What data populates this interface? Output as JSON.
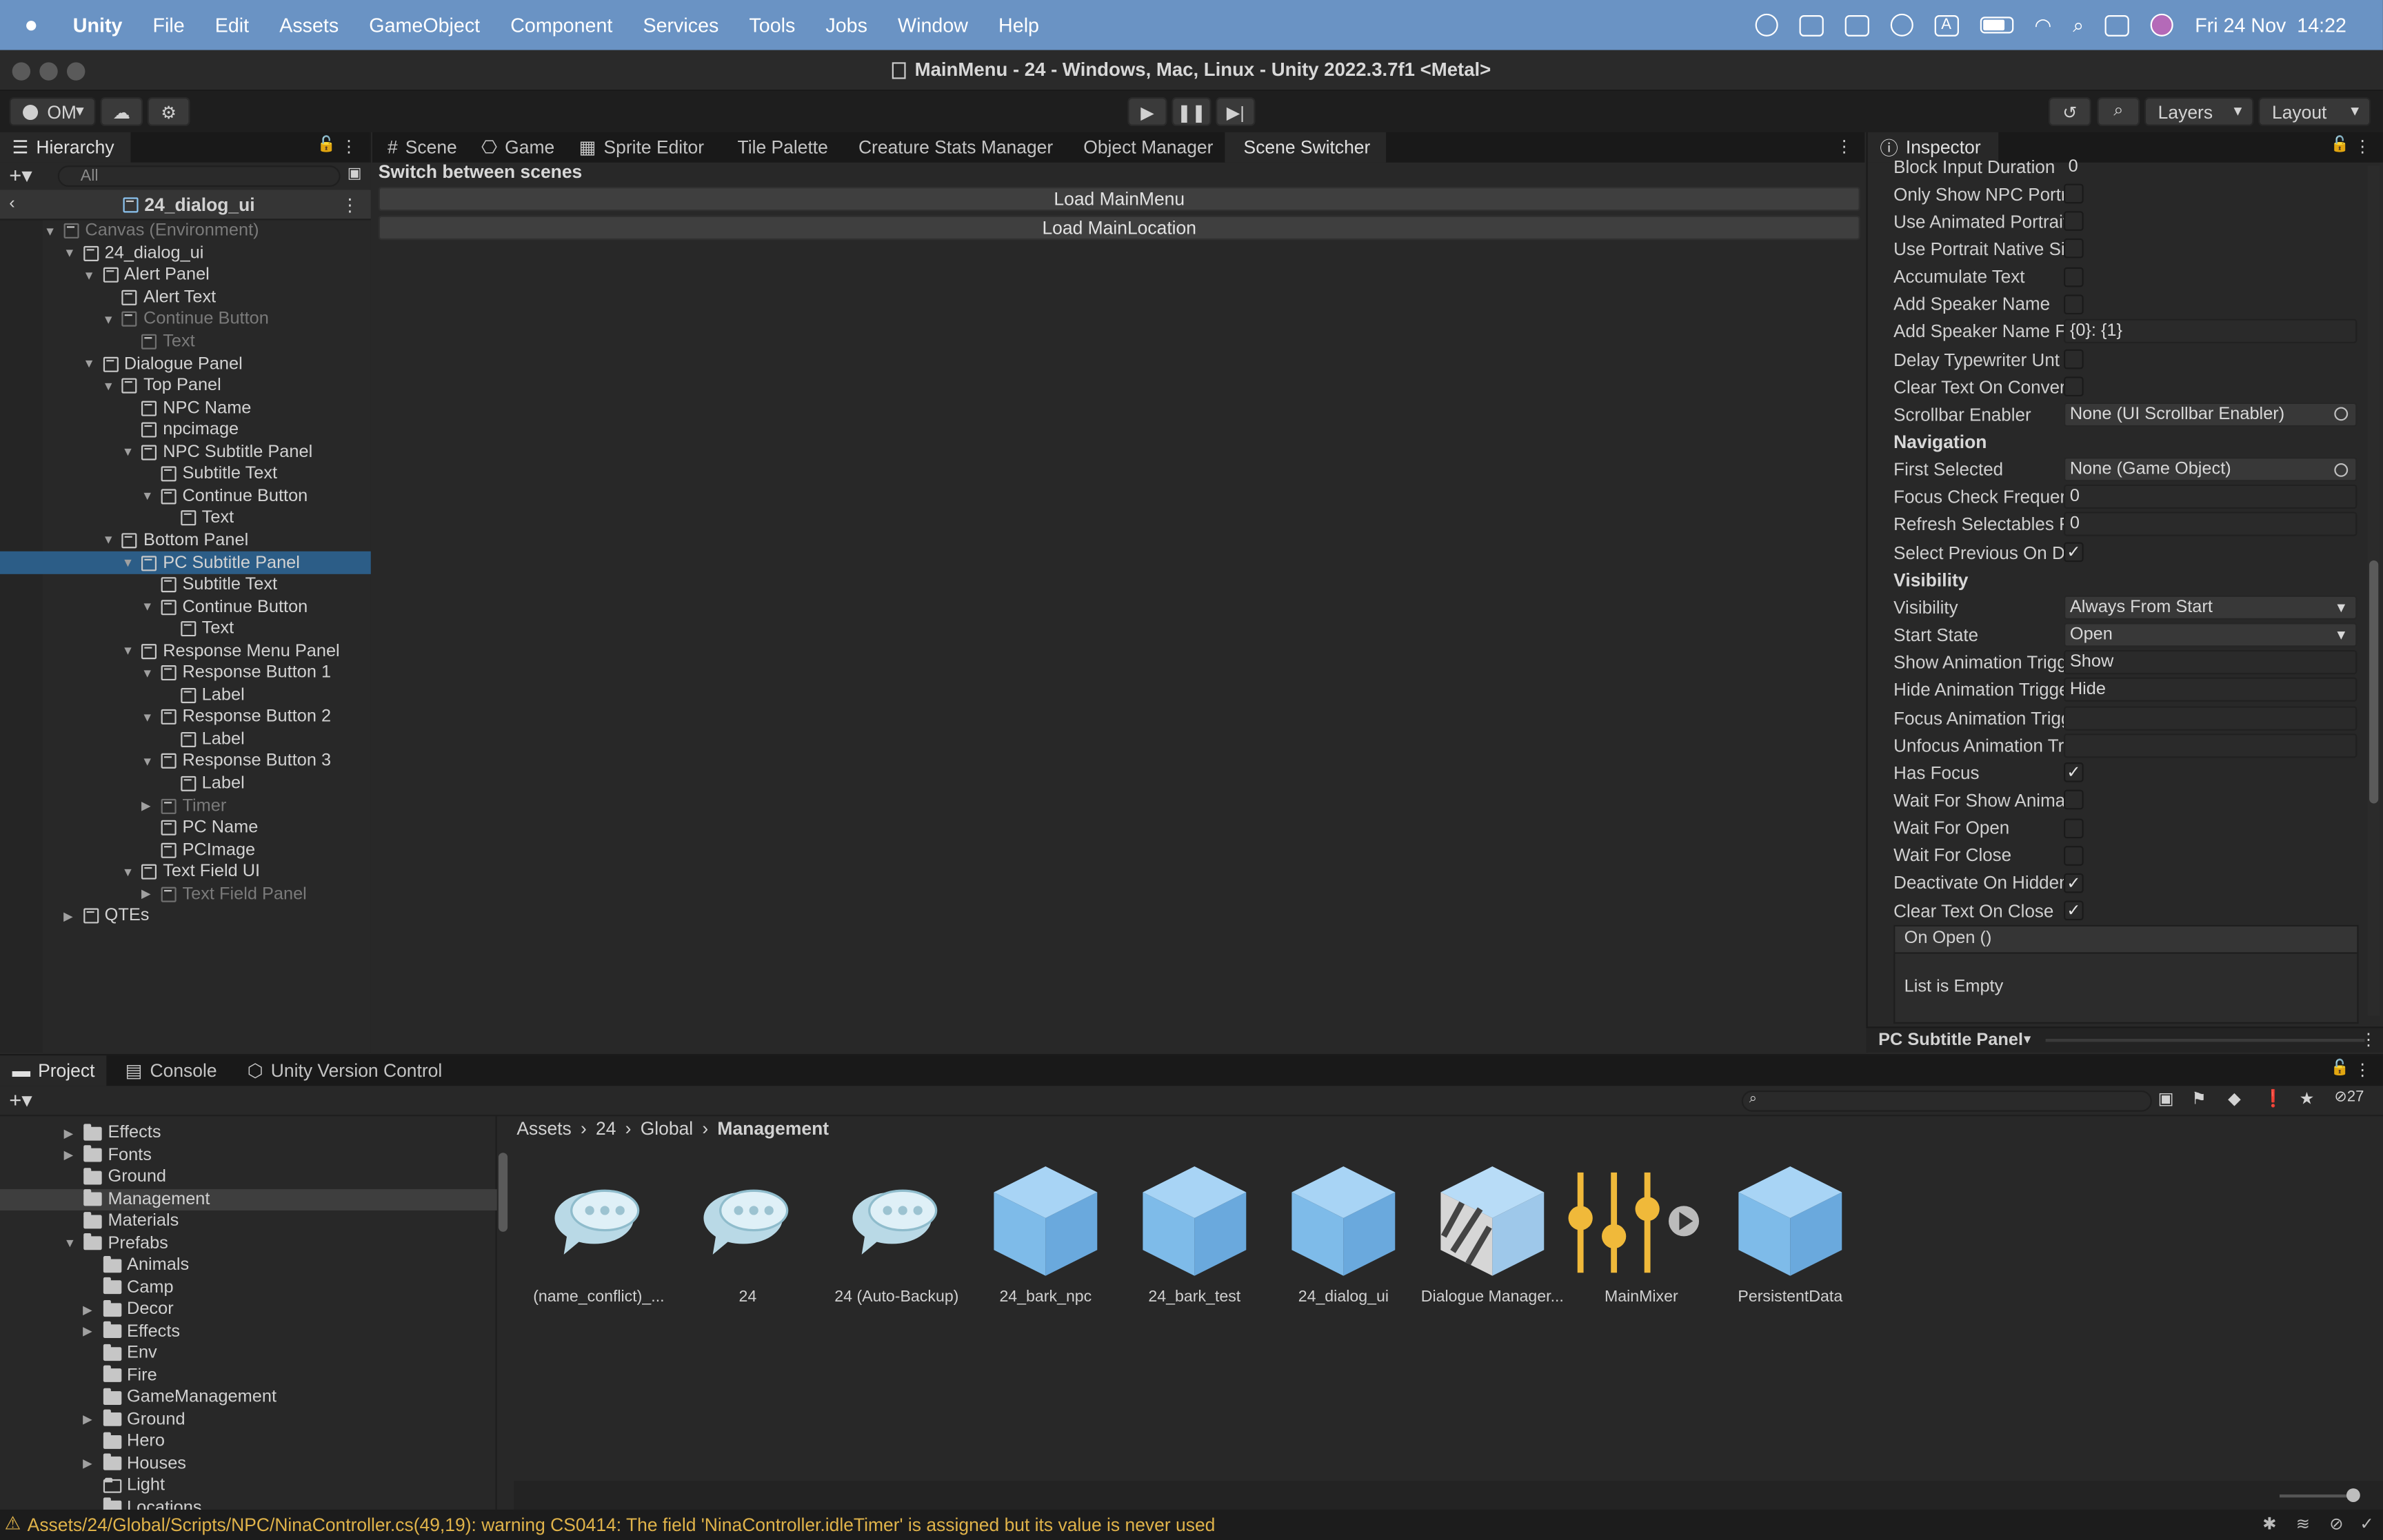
{
  "menubar": {
    "app": "Unity",
    "items": [
      "File",
      "Edit",
      "Assets",
      "GameObject",
      "Component",
      "Services",
      "Tools",
      "Jobs",
      "Window",
      "Help"
    ],
    "datetime": "Fri 24 Nov  14:22"
  },
  "window": {
    "title": "MainMenu - 24 - Windows, Mac, Linux - Unity 2022.3.7f1 <Metal>"
  },
  "toolbar": {
    "account": "OM",
    "layers": "Layers",
    "layout": "Layout"
  },
  "hierarchy": {
    "tab": "Hierarchy",
    "search_placeholder": "All",
    "root": "24_dialog_ui",
    "items": [
      {
        "label": "Canvas (Environment)",
        "dim": true
      },
      {
        "label": "24_dialog_ui"
      },
      {
        "label": "Alert Panel"
      },
      {
        "label": "Alert Text"
      },
      {
        "label": "Continue Button",
        "dim": true
      },
      {
        "label": "Text",
        "dim": true
      },
      {
        "label": "Dialogue Panel"
      },
      {
        "label": "Top Panel"
      },
      {
        "label": "NPC Name"
      },
      {
        "label": "npcimage"
      },
      {
        "label": "NPC Subtitle Panel"
      },
      {
        "label": "Subtitle Text"
      },
      {
        "label": "Continue Button"
      },
      {
        "label": "Text"
      },
      {
        "label": "Bottom Panel"
      },
      {
        "label": "PC Subtitle Panel",
        "selected": true
      },
      {
        "label": "Subtitle Text"
      },
      {
        "label": "Continue Button"
      },
      {
        "label": "Text"
      },
      {
        "label": "Response Menu Panel"
      },
      {
        "label": "Response Button 1"
      },
      {
        "label": "Label"
      },
      {
        "label": "Response Button 2"
      },
      {
        "label": "Label"
      },
      {
        "label": "Response Button 3"
      },
      {
        "label": "Label"
      },
      {
        "label": "Timer",
        "dim": true
      },
      {
        "label": "PC Name"
      },
      {
        "label": "PCImage"
      },
      {
        "label": "Text Field UI"
      },
      {
        "label": "Text Field Panel",
        "dim": true
      },
      {
        "label": "QTEs"
      }
    ]
  },
  "center_tabs": [
    "Scene",
    "Game",
    "Sprite Editor",
    "Tile Palette",
    "Creature Stats Manager",
    "Object Manager",
    "Scene Switcher"
  ],
  "scene_switcher": {
    "heading": "Switch between scenes",
    "buttons": [
      "Load MainMenu",
      "Load MainLocation"
    ]
  },
  "inspector": {
    "tab": "Inspector",
    "rows": [
      {
        "label": "Block Input Duration",
        "value": "0"
      },
      {
        "label": "Only Show NPC Portr",
        "check": false
      },
      {
        "label": "Use Animated Portrait",
        "check": false
      },
      {
        "label": "Use Portrait Native Si",
        "check": false
      },
      {
        "label": "Accumulate Text",
        "check": false
      },
      {
        "label": "Add Speaker Name",
        "check": false
      },
      {
        "label": "Add Speaker Name Fc",
        "value": "{0}: {1}"
      },
      {
        "label": "Delay Typewriter Unt",
        "check": false
      },
      {
        "label": "Clear Text On Conver",
        "check": false
      },
      {
        "label": "Scrollbar Enabler",
        "value": "None (UI Scrollbar Enabler)"
      },
      {
        "heading": "Navigation"
      },
      {
        "label": "First Selected",
        "value": "None (Game Object)"
      },
      {
        "label": "Focus Check Frequer",
        "value": "0"
      },
      {
        "label": "Refresh Selectables F",
        "value": "0"
      },
      {
        "label": "Select Previous On Di",
        "check": true
      },
      {
        "heading": "Visibility"
      },
      {
        "label": "Visibility",
        "value": "Always From Start"
      },
      {
        "label": "Start State",
        "value": "Open"
      },
      {
        "label": "Show Animation Trigg",
        "value": "Show"
      },
      {
        "label": "Hide Animation Trigge",
        "value": "Hide"
      },
      {
        "label": "Focus Animation Trigg",
        "value": ""
      },
      {
        "label": "Unfocus Animation Tr",
        "value": ""
      },
      {
        "label": "Has Focus",
        "check": true
      },
      {
        "label": "Wait For Show Animat",
        "check": false
      },
      {
        "label": "Wait For Open",
        "check": false
      },
      {
        "label": "Wait For Close",
        "check": false
      },
      {
        "label": "Deactivate On Hidden",
        "check": true
      },
      {
        "label": "Clear Text On Close",
        "check": true
      }
    ],
    "check_mark": "✓",
    "event_header": "On Open ()",
    "event_empty": "List is Empty",
    "footer": "PC Subtitle Panel"
  },
  "bottom_tabs": [
    "Project",
    "Console",
    "Unity Version Control"
  ],
  "project": {
    "count": "27",
    "folders": [
      {
        "label": "Effects"
      },
      {
        "label": "Fonts"
      },
      {
        "label": "Ground"
      },
      {
        "label": "Management",
        "selected": true
      },
      {
        "label": "Materials"
      },
      {
        "label": "Prefabs"
      },
      {
        "label": "Animals"
      },
      {
        "label": "Camp"
      },
      {
        "label": "Decor"
      },
      {
        "label": "Effects"
      },
      {
        "label": "Env"
      },
      {
        "label": "Fire"
      },
      {
        "label": "GameManagement"
      },
      {
        "label": "Ground"
      },
      {
        "label": "Hero"
      },
      {
        "label": "Houses"
      },
      {
        "label": "Light"
      },
      {
        "label": "Locations"
      }
    ],
    "breadcrumb": [
      "Assets",
      "24",
      "Global",
      "Management"
    ],
    "assets": [
      {
        "label": "(name_conflict)_...",
        "icon": "dialogue-db-icon"
      },
      {
        "label": "24",
        "icon": "dialogue-db-icon"
      },
      {
        "label": "24 (Auto-Backup)",
        "icon": "dialogue-db-icon"
      },
      {
        "label": "24_bark_npc",
        "icon": "prefab-cube-icon"
      },
      {
        "label": "24_bark_test",
        "icon": "prefab-cube-icon"
      },
      {
        "label": "24_dialog_ui",
        "icon": "prefab-cube-icon"
      },
      {
        "label": "Dialogue Manager...",
        "icon": "prefab-variant-icon"
      },
      {
        "label": "MainMixer",
        "icon": "audio-mixer-icon"
      },
      {
        "label": "PersistentData",
        "icon": "prefab-cube-icon"
      }
    ]
  },
  "status": {
    "message": "Assets/24/Global/Scripts/NPC/NinaController.cs(49,19): warning CS0414: The field 'NinaController.idleTimer' is assigned but its value is never used"
  },
  "colors": {
    "menubar": "#6a93c4",
    "selection": "#2c5d87",
    "prefab": "#8cc4f0",
    "warning": "#e0b34a",
    "mixer": "#f0b93a"
  }
}
